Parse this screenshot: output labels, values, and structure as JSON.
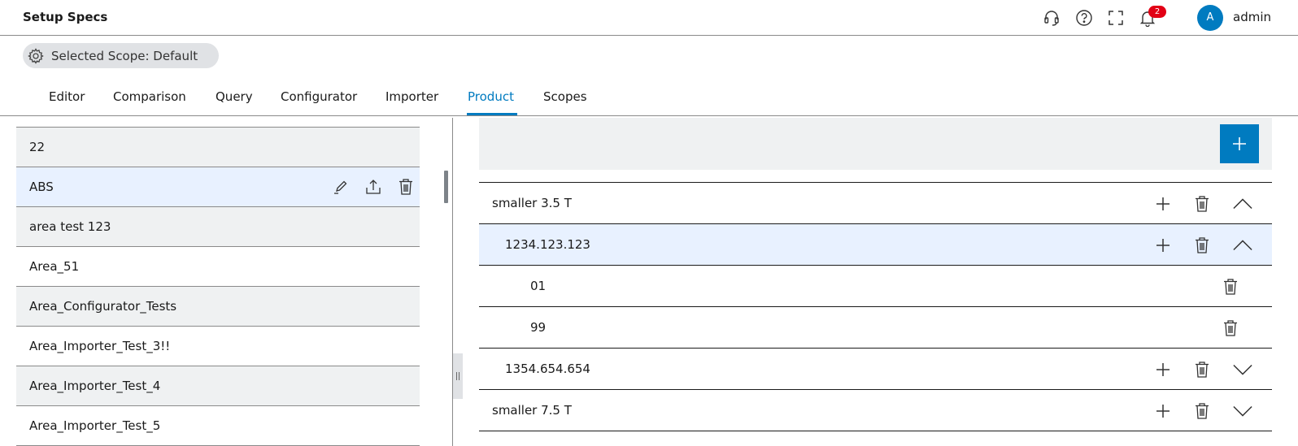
{
  "header": {
    "title": "Setup Specs",
    "icons": [
      "headset-icon",
      "help-icon",
      "fullscreen-icon",
      "notification-bell-icon"
    ],
    "notification_count": "2",
    "avatar_initial": "A",
    "user_name": "admin"
  },
  "scope": {
    "label": "Selected Scope: Default",
    "icon": "gear-icon"
  },
  "tabs": [
    {
      "label": "Editor"
    },
    {
      "label": "Comparison"
    },
    {
      "label": "Query"
    },
    {
      "label": "Configurator"
    },
    {
      "label": "Importer"
    },
    {
      "label": "Product",
      "active": true
    },
    {
      "label": "Scopes"
    }
  ],
  "left_list": {
    "items": [
      {
        "label": "22"
      },
      {
        "label": "ABS",
        "selected": true
      },
      {
        "label": "area test 123"
      },
      {
        "label": "Area_51"
      },
      {
        "label": "Area_Configurator_Tests"
      },
      {
        "label": "Area_Importer_Test_3!!"
      },
      {
        "label": "Area_Importer_Test_4"
      },
      {
        "label": "Area_Importer_Test_5"
      }
    ],
    "row_action_icons": [
      "edit-icon",
      "export-icon",
      "delete-icon"
    ]
  },
  "tree": {
    "add_icon": "plus-icon",
    "rows": [
      {
        "label": "smaller 3.5 T",
        "level": 0,
        "expanded": true
      },
      {
        "label": "1234.123.123",
        "level": 1,
        "expanded": true,
        "selected": true
      },
      {
        "label": "01",
        "level": 2
      },
      {
        "label": "99",
        "level": 2
      },
      {
        "label": "1354.654.654",
        "level": 1,
        "expanded": false
      },
      {
        "label": "smaller 7.5 T",
        "level": 0,
        "expanded": false
      }
    ]
  },
  "colors": {
    "accent": "#007bc0",
    "badge": "#e20015",
    "selected_row": "#e8f1ff",
    "grey_row": "#eff1f2"
  }
}
